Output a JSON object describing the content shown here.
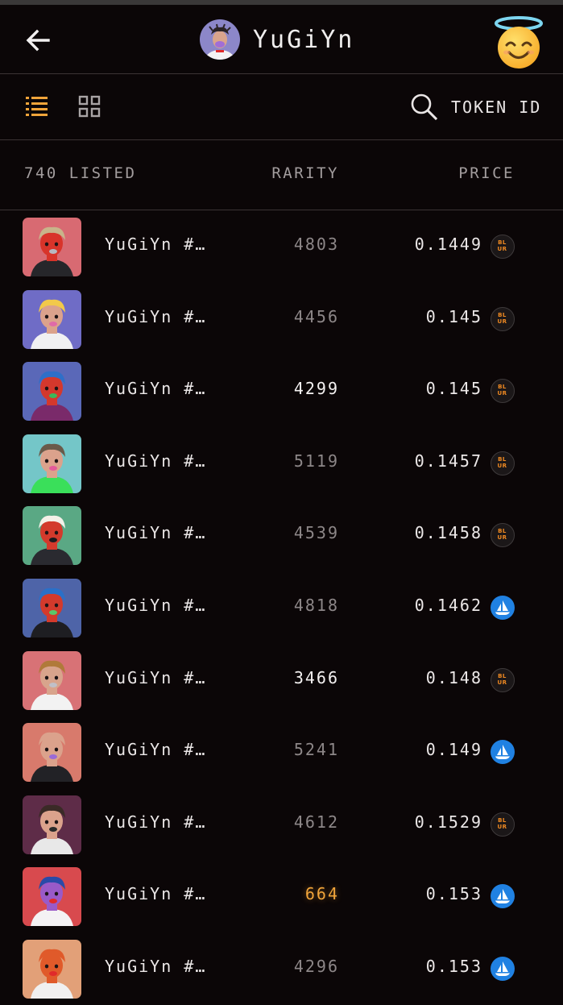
{
  "header": {
    "collection_name": "YuGiYn"
  },
  "toolbar": {
    "search_label": "TOKEN ID"
  },
  "columns": {
    "listed": "740 LISTED",
    "rarity": "RARITY",
    "price": "PRICE"
  },
  "colors": {
    "accent": "#f0a43a",
    "blur_orange": "#f08a22",
    "opensea_blue": "#2081e2"
  },
  "rows": [
    {
      "name": "YuGiYn #…",
      "rarity": "4803",
      "price": "0.1449",
      "marketplace": "blur-icon"
    },
    {
      "name": "YuGiYn #…",
      "rarity": "4456",
      "price": "0.145",
      "marketplace": "blur-icon"
    },
    {
      "name": "YuGiYn #…",
      "rarity": "4299",
      "price": "0.145",
      "marketplace": "blur-icon"
    },
    {
      "name": "YuGiYn #…",
      "rarity": "5119",
      "price": "0.1457",
      "marketplace": "blur-icon"
    },
    {
      "name": "YuGiYn #…",
      "rarity": "4539",
      "price": "0.1458",
      "marketplace": "blur-icon"
    },
    {
      "name": "YuGiYn #…",
      "rarity": "4818",
      "price": "0.1462",
      "marketplace": "opensea-icon"
    },
    {
      "name": "YuGiYn #…",
      "rarity": "3466",
      "price": "0.148",
      "marketplace": "blur-icon"
    },
    {
      "name": "YuGiYn #…",
      "rarity": "5241",
      "price": "0.149",
      "marketplace": "opensea-icon"
    },
    {
      "name": "YuGiYn #…",
      "rarity": "4612",
      "price": "0.1529",
      "marketplace": "blur-icon"
    },
    {
      "name": "YuGiYn #…",
      "rarity": "664",
      "price": "0.153",
      "marketplace": "opensea-icon"
    },
    {
      "name": "YuGiYn #…",
      "rarity": "4296",
      "price": "0.153",
      "marketplace": "opensea-icon"
    }
  ],
  "blur_logo_text": "BLUR"
}
